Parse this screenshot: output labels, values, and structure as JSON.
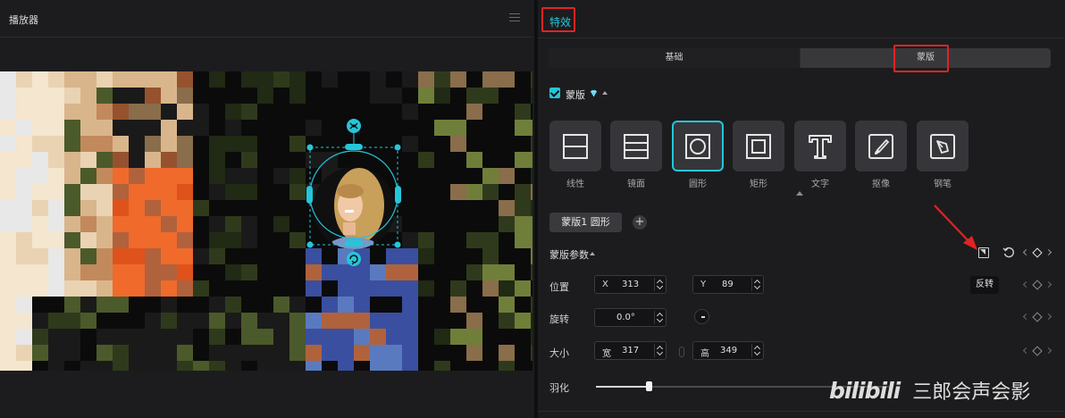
{
  "player": {
    "title": "播放器"
  },
  "panel": {
    "tab_label": "特效",
    "segments": {
      "basic": "基础",
      "mask": "蒙版"
    },
    "mask_toggle": {
      "label": "蒙版",
      "checked": true
    },
    "shapes": [
      {
        "label": "线性",
        "icon": "linear-mask-icon",
        "selected": false
      },
      {
        "label": "镜面",
        "icon": "mirror-mask-icon",
        "selected": false
      },
      {
        "label": "圆形",
        "icon": "circle-mask-icon",
        "selected": true
      },
      {
        "label": "矩形",
        "icon": "rectangle-mask-icon",
        "selected": false
      },
      {
        "label": "文字",
        "icon": "text-mask-icon",
        "selected": false
      },
      {
        "label": "抠像",
        "icon": "cutout-mask-icon",
        "selected": false
      },
      {
        "label": "钢笔",
        "icon": "pen-mask-icon",
        "selected": false
      }
    ],
    "mask_chip": "蒙版1 圆形",
    "add_label": "+",
    "params_title": "蒙版参数",
    "invert_tooltip": "反转",
    "position": {
      "label": "位置",
      "x_prefix": "X",
      "x": "313",
      "y_prefix": "Y",
      "y": "89"
    },
    "rotation": {
      "label": "旋转",
      "value": "0.0°"
    },
    "size": {
      "label": "大小",
      "w_prefix": "宽",
      "w": "317",
      "h_prefix": "高",
      "h": "349"
    },
    "feather": {
      "label": "羽化",
      "level": 0.18
    }
  },
  "watermark": {
    "logo": "bilibili",
    "text": "三郎会声会影"
  },
  "colors": {
    "accent": "#25c6d9",
    "highlight": "#e02424",
    "panel": "#1c1c1e"
  }
}
